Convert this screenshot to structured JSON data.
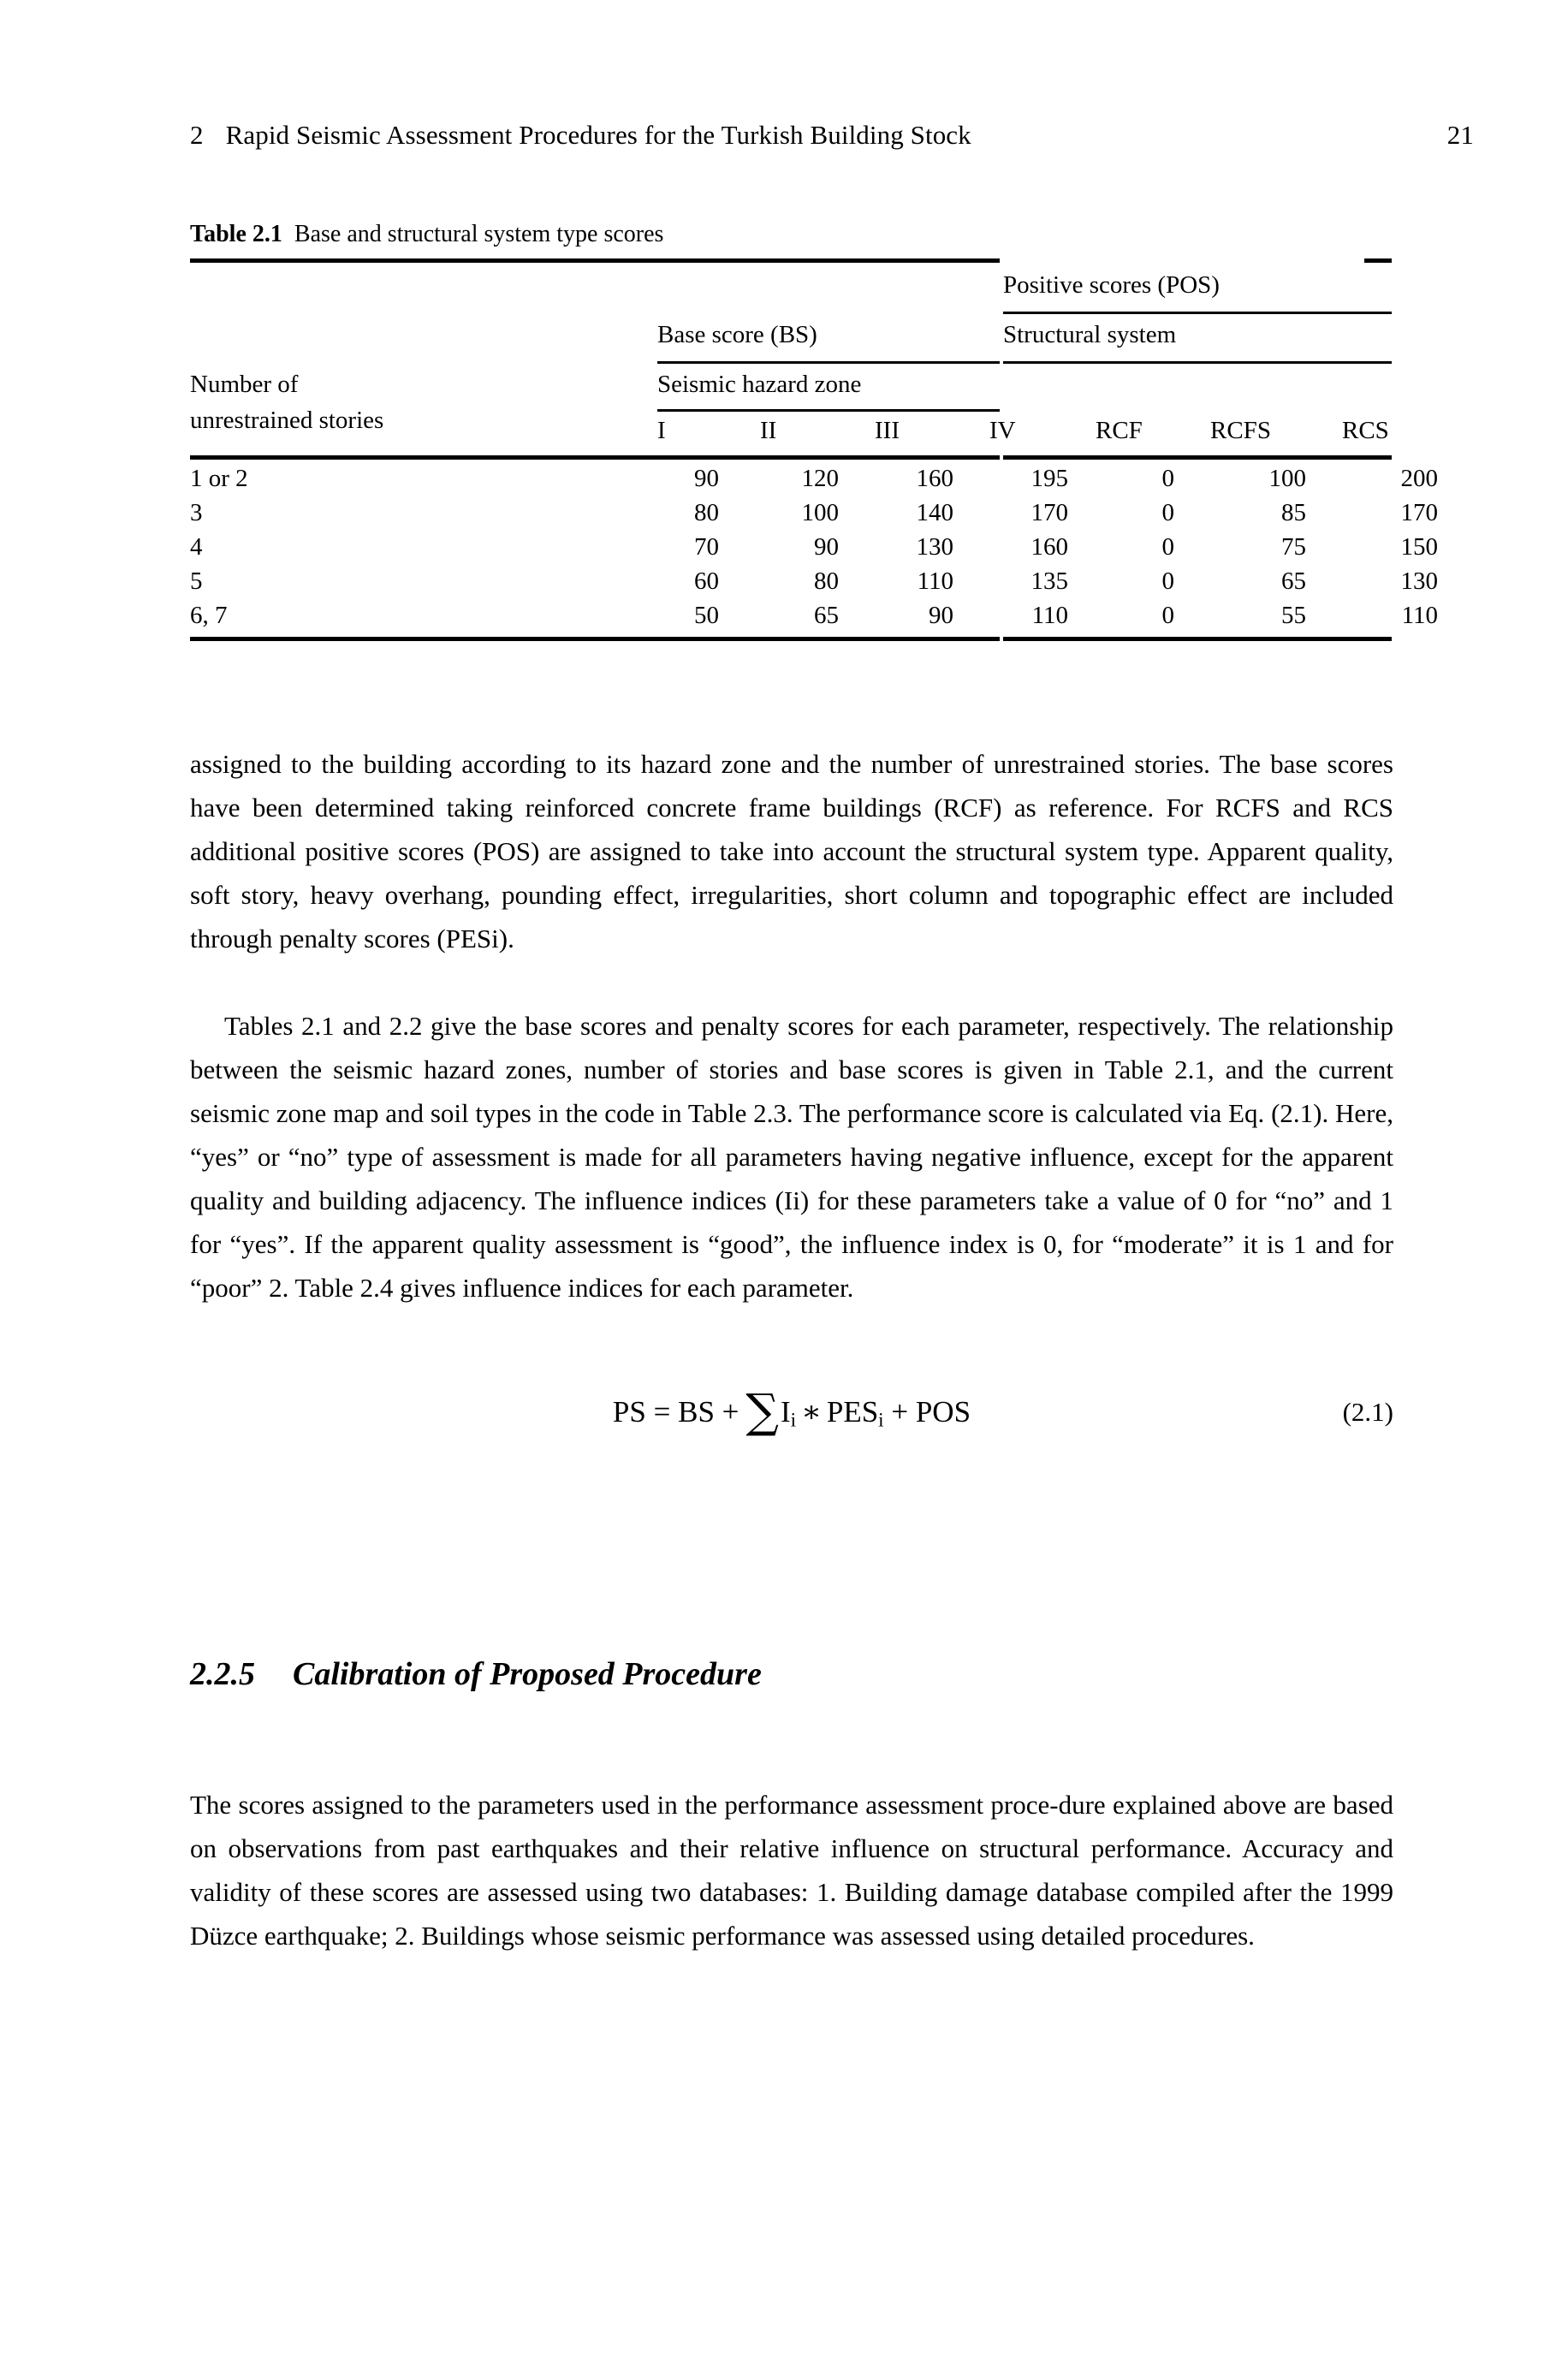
{
  "running_head": {
    "chapter_number": "2",
    "title": "Rapid Seismic Assessment Procedures for the Turkish Building Stock",
    "page_number": "21"
  },
  "table": {
    "caption_label": "Table 2.1",
    "caption_text": "Base and structural system type scores",
    "group_headers": {
      "positive_scores": "Positive scores (POS)",
      "base_score": "Base score (BS)",
      "structural_system": "Structural system",
      "seismic_hazard_zone": "Seismic hazard zone"
    },
    "stub_header_line1": "Number of",
    "stub_header_line2": "unrestrained stories",
    "column_headers": [
      "I",
      "II",
      "III",
      "IV",
      "RCF",
      "RCFS",
      "RCS"
    ],
    "rows": [
      {
        "stories": "1 or 2",
        "I": "90",
        "II": "120",
        "III": "160",
        "IV": "195",
        "RCF": "0",
        "RCFS": "100",
        "RCS": "200"
      },
      {
        "stories": "3",
        "I": "80",
        "II": "100",
        "III": "140",
        "IV": "170",
        "RCF": "0",
        "RCFS": "85",
        "RCS": "170"
      },
      {
        "stories": "4",
        "I": "70",
        "II": "90",
        "III": "130",
        "IV": "160",
        "RCF": "0",
        "RCFS": "75",
        "RCS": "150"
      },
      {
        "stories": "5",
        "I": "60",
        "II": "80",
        "III": "110",
        "IV": "135",
        "RCF": "0",
        "RCFS": "65",
        "RCS": "130"
      },
      {
        "stories": "6, 7",
        "I": "50",
        "II": "65",
        "III": "90",
        "IV": "110",
        "RCF": "0",
        "RCFS": "55",
        "RCS": "110"
      }
    ]
  },
  "body": {
    "paragraph_1": "assigned to the building according to its hazard zone and the number of unrestrained stories. The base scores have been determined taking reinforced concrete frame buildings (RCF) as reference. For RCFS and RCS additional positive scores (POS) are assigned to take into account the structural system type. Apparent quality, soft story, heavy overhang, pounding effect, irregularities, short column and topographic effect are included through penalty scores (PESi).",
    "paragraph_2": "Tables 2.1 and 2.2 give the base scores and penalty scores for each parameter, respectively. The relationship between the seismic hazard zones, number of stories and base scores is given in Table 2.1, and the current seismic zone map and soil types in the code in Table 2.3. The performance score is calculated via Eq. (2.1). Here, “yes” or “no” type of assessment is made for all parameters having negative influence, except for the apparent quality and building adjacency. The influence indices (Ii) for these parameters take a value of 0 for “no” and 1 for “yes”. If the apparent quality assessment is “good”, the influence index is 0, for “moderate” it is 1 and for “poor” 2. Table 2.4 gives influence indices for each parameter.",
    "paragraph_3": "The scores assigned to the parameters used in the performance assessment proce-dure explained above are based on observations from past earthquakes and their relative influence on structural performance. Accuracy and validity of these scores are assessed using two databases: 1. Building damage database compiled after the 1999 Düzce earthquake; 2. Buildings whose seismic performance was assessed using detailed procedures."
  },
  "equation": {
    "lhs": "PS",
    "equals": "=",
    "bs": "BS",
    "plus_1": "+",
    "sigma": "∑",
    "influence_symbol": "I",
    "influence_subscript": "i",
    "asterisk": "∗",
    "pes_symbol": "PES",
    "pes_subscript": "i",
    "plus_2": "+",
    "pos": "POS",
    "number": "(2.1)"
  },
  "section": {
    "number": "2.2.5",
    "title": "Calibration of Proposed Procedure"
  }
}
